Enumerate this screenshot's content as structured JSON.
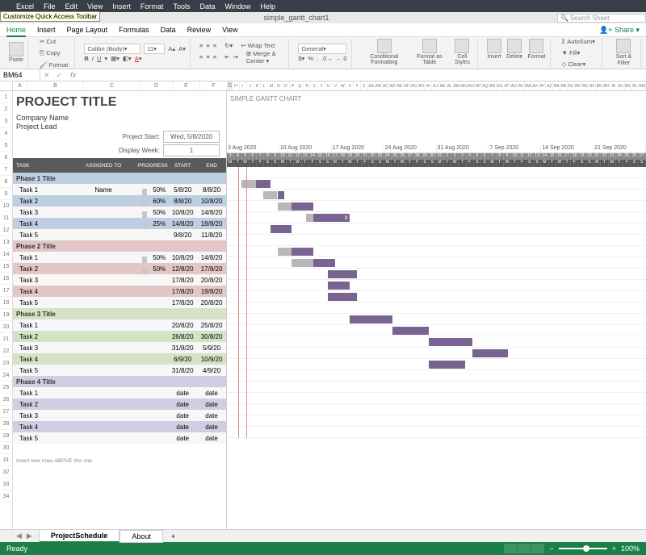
{
  "menubar": [
    "Excel",
    "File",
    "Edit",
    "View",
    "Insert",
    "Format",
    "Tools",
    "Data",
    "Window",
    "Help"
  ],
  "tooltip": "Customize Quick Access Toolbar",
  "filename": "simple_gantt_chart1",
  "search_placeholder": "Search Sheet",
  "ribbon_tabs": [
    "Home",
    "Insert",
    "Page Layout",
    "Formulas",
    "Data",
    "Review",
    "View"
  ],
  "share_label": "Share",
  "clipboard": {
    "paste": "Paste",
    "cut": "Cut",
    "copy": "Copy",
    "format": "Format"
  },
  "font": {
    "name": "Calibri (Body)",
    "size": "11"
  },
  "align": {
    "wrap": "Wrap Text",
    "merge": "Merge & Center"
  },
  "number_format": "General",
  "cmds": {
    "cf": "Conditional Formatting",
    "fat": "Format as Table",
    "cs": "Cell Styles",
    "ins": "Insert",
    "del": "Delete",
    "fmt": "Format",
    "as": "AutoSum",
    "fill": "Fill",
    "clr": "Clear",
    "sf": "Sort & Filter"
  },
  "cell_ref": "BM64",
  "doc": {
    "title": "PROJECT TITLE",
    "subtitle": "SIMPLE GANTT CHART",
    "company": "Company Name",
    "lead": "Project Lead",
    "ps_label": "Project Start:",
    "ps_value": "Wed, 5/8/2020",
    "dw_label": "Display Week:",
    "dw_value": "1"
  },
  "headers": {
    "task": "TASK",
    "assigned": "ASSIGNED TO",
    "progress": "PROGRESS",
    "start": "START",
    "end": "END"
  },
  "weeks": [
    "3 Aug 2020",
    "10 Aug 2020",
    "17 Aug 2020",
    "24 Aug 2020",
    "31 Aug 2020",
    "7 Sep 2020",
    "14 Sep 2020",
    "21 Sep 2020"
  ],
  "phases": [
    {
      "name": "Phase 1 Title",
      "cls": "pblue",
      "tasks": [
        {
          "t": "Task 1",
          "a": "Name",
          "p": "50%",
          "s": "5/8/20",
          "e": "8/8/20",
          "gs": 2,
          "gw": 4,
          "grey": 2
        },
        {
          "t": "Task 2",
          "a": "",
          "p": "60%",
          "s": "8/8/20",
          "e": "10/8/20",
          "gs": 5,
          "gw": 3,
          "grey": 2
        },
        {
          "t": "Task 3",
          "a": "",
          "p": "50%",
          "s": "10/8/20",
          "e": "14/8/20",
          "gs": 7,
          "gw": 5,
          "grey": 2
        },
        {
          "t": "Task 4",
          "a": "",
          "p": "25%",
          "s": "14/8/20",
          "e": "19/8/20",
          "gs": 11,
          "gw": 6,
          "grey": 1,
          "mark": "x"
        },
        {
          "t": "Task 5",
          "a": "",
          "p": "",
          "s": "9/8/20",
          "e": "11/8/20",
          "gs": 6,
          "gw": 3
        }
      ]
    },
    {
      "name": "Phase 2 Title",
      "cls": "pred",
      "tasks": [
        {
          "t": "Task 1",
          "a": "",
          "p": "50%",
          "s": "10/8/20",
          "e": "14/8/20",
          "gs": 7,
          "gw": 5,
          "grey": 2
        },
        {
          "t": "Task 2",
          "a": "",
          "p": "50%",
          "s": "12/8/20",
          "e": "17/8/20",
          "gs": 9,
          "gw": 6,
          "grey": 3
        },
        {
          "t": "Task 3",
          "a": "",
          "p": "",
          "s": "17/8/20",
          "e": "20/8/20",
          "gs": 14,
          "gw": 4
        },
        {
          "t": "Task 4",
          "a": "",
          "p": "",
          "s": "17/8/20",
          "e": "19/8/20",
          "gs": 14,
          "gw": 3
        },
        {
          "t": "Task 5",
          "a": "",
          "p": "",
          "s": "17/8/20",
          "e": "20/8/20",
          "gs": 14,
          "gw": 4
        }
      ]
    },
    {
      "name": "Phase 3 Title",
      "cls": "pgreen",
      "tasks": [
        {
          "t": "Task 1",
          "a": "",
          "p": "",
          "s": "20/8/20",
          "e": "25/8/20",
          "gs": 17,
          "gw": 6
        },
        {
          "t": "Task 2",
          "a": "",
          "p": "",
          "s": "26/8/20",
          "e": "30/8/20",
          "gs": 23,
          "gw": 5
        },
        {
          "t": "Task 3",
          "a": "",
          "p": "",
          "s": "31/8/20",
          "e": "5/9/20",
          "gs": 28,
          "gw": 6
        },
        {
          "t": "Task 4",
          "a": "",
          "p": "",
          "s": "6/9/20",
          "e": "10/9/20",
          "gs": 34,
          "gw": 5
        },
        {
          "t": "Task 5",
          "a": "",
          "p": "",
          "s": "31/8/20",
          "e": "4/9/20",
          "gs": 28,
          "gw": 5
        }
      ]
    },
    {
      "name": "Phase 4 Title",
      "cls": "ppurple",
      "tasks": [
        {
          "t": "Task 1",
          "a": "",
          "p": "",
          "s": "date",
          "e": "date"
        },
        {
          "t": "Task 2",
          "a": "",
          "p": "",
          "s": "date",
          "e": "date"
        },
        {
          "t": "Task 3",
          "a": "",
          "p": "",
          "s": "date",
          "e": "date"
        },
        {
          "t": "Task 4",
          "a": "",
          "p": "",
          "s": "date",
          "e": "date"
        },
        {
          "t": "Task 5",
          "a": "",
          "p": "",
          "s": "date",
          "e": "date"
        }
      ]
    }
  ],
  "note": "Insert new rows ABOVE this one",
  "sheet_tabs": [
    "ProjectSchedule",
    "About"
  ],
  "status": "Ready",
  "zoom": "100%"
}
